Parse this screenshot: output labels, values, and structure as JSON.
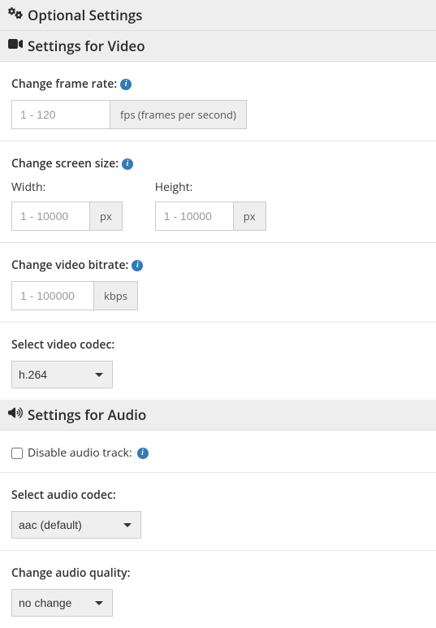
{
  "headers": {
    "optional": "Optional Settings",
    "video": "Settings for Video",
    "audio": "Settings for Audio"
  },
  "video": {
    "framerate": {
      "label": "Change frame rate:",
      "placeholder": "1 - 120",
      "unit": "fps (frames per second)"
    },
    "screensize": {
      "label": "Change screen size:",
      "width_label": "Width:",
      "width_placeholder": "1 - 10000",
      "width_unit": "px",
      "height_label": "Height:",
      "height_placeholder": "1 - 10000",
      "height_unit": "px"
    },
    "bitrate": {
      "label": "Change video bitrate:",
      "placeholder": "1 - 100000",
      "unit": "kbps"
    },
    "codec": {
      "label": "Select video codec:",
      "selected": "h.264"
    }
  },
  "audio": {
    "disable": {
      "label": "Disable audio track:"
    },
    "codec": {
      "label": "Select audio codec:",
      "selected": "aac (default)"
    },
    "quality": {
      "label": "Change audio quality:",
      "selected": "no change"
    }
  }
}
